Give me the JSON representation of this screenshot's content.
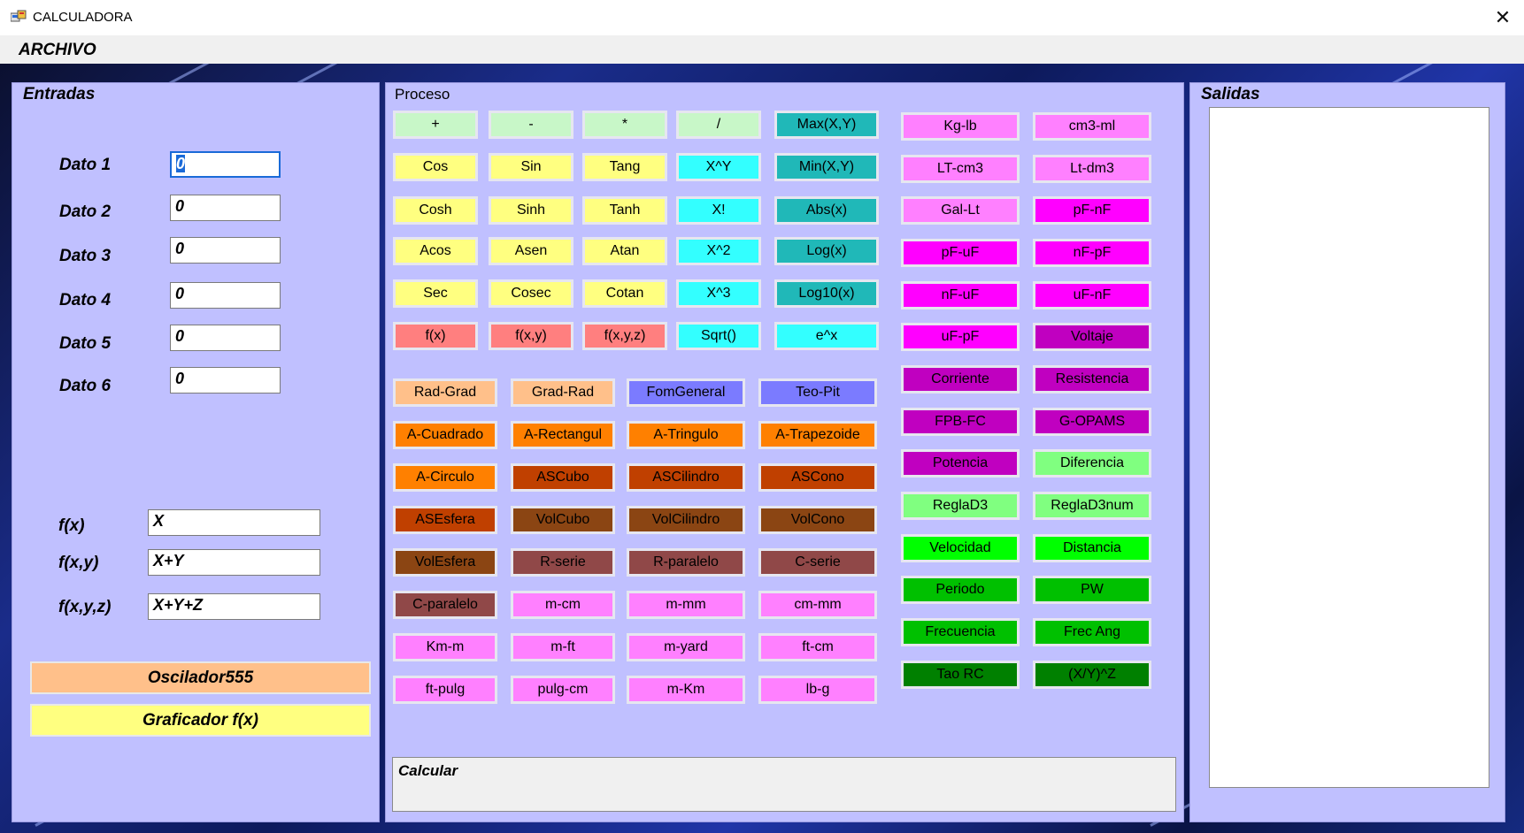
{
  "window": {
    "title": "CALCULADORA",
    "menu": "ARCHIVO"
  },
  "entradas": {
    "title": "Entradas",
    "datos": [
      {
        "label": "Dato 1",
        "value": "0"
      },
      {
        "label": "Dato 2",
        "value": "0"
      },
      {
        "label": "Dato 3",
        "value": "0"
      },
      {
        "label": "Dato 4",
        "value": "0"
      },
      {
        "label": "Dato 5",
        "value": "0"
      },
      {
        "label": "Dato 6",
        "value": "0"
      }
    ],
    "funciones": [
      {
        "label": "f(x)",
        "value": "X"
      },
      {
        "label": "f(x,y)",
        "value": "X+Y"
      },
      {
        "label": "f(x,y,z)",
        "value": "X+Y+Z"
      }
    ],
    "oscilador": "Oscilador555",
    "graficador": "Graficador f(x)"
  },
  "proceso": {
    "title": "Proceso",
    "calcular": "Calcular",
    "top": [
      [
        "+",
        "-",
        "*",
        "/",
        "Max(X,Y)"
      ],
      [
        "Cos",
        "Sin",
        "Tang",
        "X^Y",
        "Min(X,Y)"
      ],
      [
        "Cosh",
        "Sinh",
        "Tanh",
        "X!",
        "Abs(x)"
      ],
      [
        "Acos",
        "Asen",
        "Atan",
        "X^2",
        "Log(x)"
      ],
      [
        "Sec",
        "Cosec",
        "Cotan",
        "X^3",
        "Log10(x)"
      ],
      [
        "f(x)",
        "f(x,y)",
        "f(x,y,z)",
        "Sqrt()",
        "e^x"
      ]
    ],
    "grid": [
      [
        "Rad-Grad",
        "Grad-Rad",
        "FomGeneral",
        "Teo-Pit"
      ],
      [
        "A-Cuadrado",
        "A-Rectangul",
        "A-Tringulo",
        "A-Trapezoide"
      ],
      [
        "A-Circulo",
        "ASCubo",
        "ASCilindro",
        "ASCono"
      ],
      [
        "ASEsfera",
        "VolCubo",
        "VolCilindro",
        "VolCono"
      ],
      [
        "VolEsfera",
        "R-serie",
        "R-paralelo",
        "C-serie"
      ],
      [
        "C-paralelo",
        "m-cm",
        "m-mm",
        "cm-mm"
      ],
      [
        "Km-m",
        "m-ft",
        "m-yard",
        "ft-cm"
      ],
      [
        "ft-pulg",
        "pulg-cm",
        "m-Km",
        "lb-g"
      ]
    ],
    "right": [
      [
        "Kg-lb",
        "cm3-ml"
      ],
      [
        "LT-cm3",
        "Lt-dm3"
      ],
      [
        "Gal-Lt",
        "pF-nF"
      ],
      [
        "pF-uF",
        "nF-pF"
      ],
      [
        "nF-uF",
        "uF-nF"
      ],
      [
        "uF-pF",
        "Voltaje"
      ],
      [
        "Corriente",
        "Resistencia"
      ],
      [
        "FPB-FC",
        "G-OPAMS"
      ],
      [
        "Potencia",
        "Diferencia"
      ],
      [
        "ReglaD3",
        "ReglaD3num"
      ],
      [
        "Velocidad",
        "Distancia"
      ],
      [
        "Periodo",
        "PW"
      ],
      [
        "Frecuencia",
        "Frec Ang"
      ],
      [
        "Tao RC",
        "(X/Y)^Z"
      ]
    ]
  },
  "salidas": {
    "title": "Salidas"
  },
  "colors": {
    "panel": "#c0c0ff",
    "lightgreen": "#c8f7c8",
    "yellow": "#ffff80",
    "cyan": "#33ffff",
    "teal": "#20b8b8",
    "salmon": "#ff7f7f",
    "peach": "#ffc08a",
    "blue": "#7b7bff",
    "orange": "#ff8000",
    "rust": "#c04000",
    "brown": "#8b4513",
    "plum": "#904848",
    "pink": "#ff80ff",
    "magenta": "#ff00ff",
    "purple": "#c000c0",
    "mint": "#80ff80",
    "green": "#00ff00",
    "dgreen": "#00c000",
    "darkgreen": "#008000"
  }
}
